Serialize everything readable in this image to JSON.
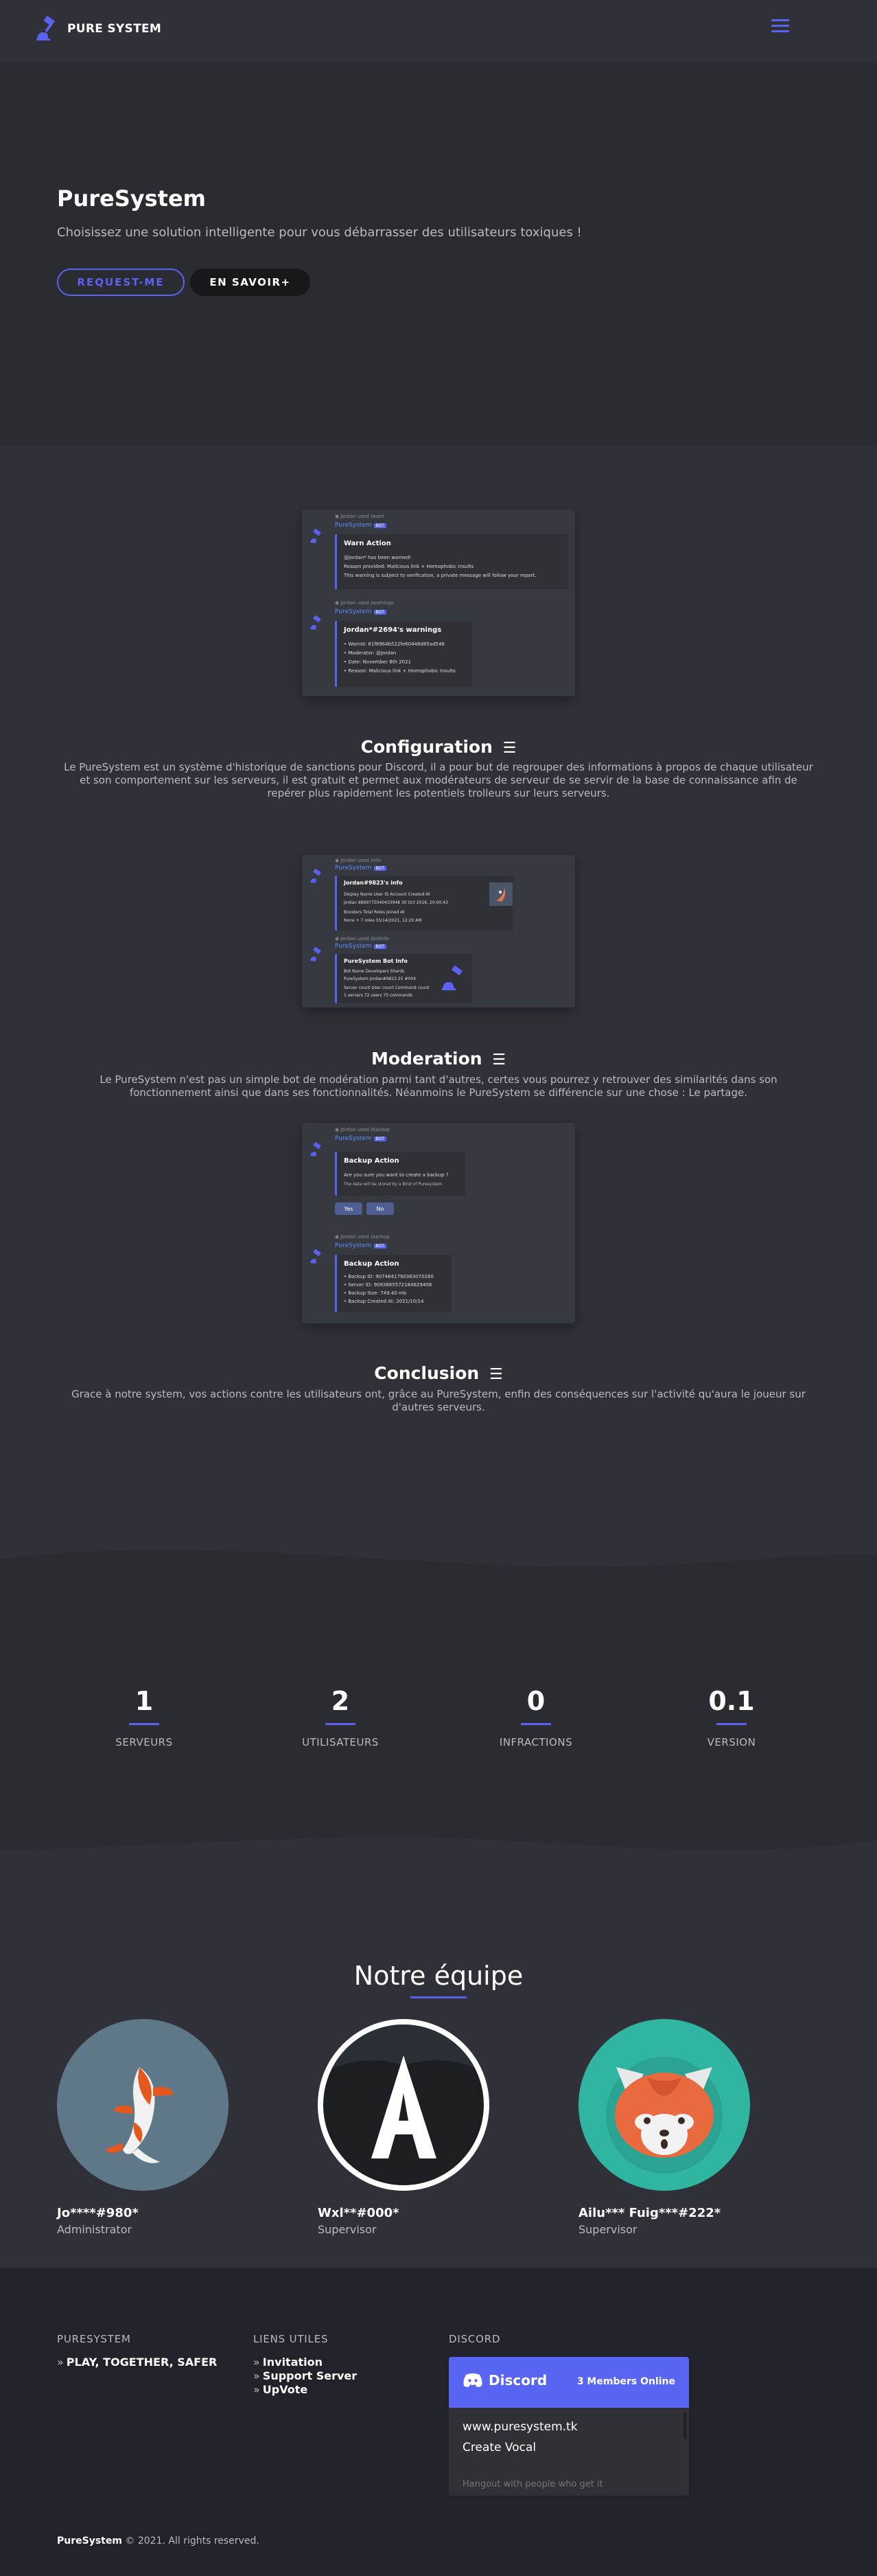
{
  "header": {
    "brand": "PURE SYSTEM"
  },
  "hero": {
    "title": "PureSystem",
    "subtitle": "Choisissez une solution intelligente pour vous débarrasser des utilisateurs toxiques !",
    "request_button": "REQUEST-ME",
    "savoir_button": "EN SAVOIR+"
  },
  "features": [
    {
      "title": "Configuration",
      "description": "Le PureSystem est un système d'historique de sanctions pour Discord, il a pour but de regrouper des informations à propos de chaque utilisateur et son comportement sur les serveurs, il est gratuit et permet aux modérateurs de serveur de se servir de la base de connaissance afin de repérer plus rapidement les potentiels trolleurs sur leurs serveurs."
    },
    {
      "title": "Moderation",
      "description": "Le PureSystem n'est pas un simple bot de modération parmi tant d'autres, certes vous pourrez y retrouver des similarités dans son fonctionnement ainsi que dans ses fonctionnalités. Néanmoins le PureSystem se différencie sur une chose : Le partage."
    },
    {
      "title": "Conclusion",
      "description": "Grace à notre system, vos actions contre les utilisateurs ont, grâce au PureSystem, enfin des conséquences sur l'activité qu'aura le joueur sur d'autres serveurs."
    }
  ],
  "screens": {
    "bot_name": "PureSystem",
    "bot_tag": "BOT",
    "warn": {
      "title": "Warn Action",
      "line1": "@Jordan* has been warned!",
      "line2": "Reason provided: Malicious link + Homophobic insults",
      "line3": "This warning is subject to verification, a private message will follow your report."
    },
    "warnings": {
      "title": "Jordan*#2694's warnings",
      "line1": "• WarnId: 61f8964b522fe60446d85ad546",
      "line2": "• Moderator: @Jordan",
      "line3": "• Date: November 8th 2021",
      "line4": "• Reason: Malicious link + Homophobic insults"
    },
    "info": {
      "title": "Jordan#9823's info",
      "line1": "Display Name   User ID   Account Created At",
      "line2": "Jordan   8899775040433948   30 Oct 2018, 20:00:43",
      "line3": "Boosters   Total Roles   Joined At",
      "line4": "None   + 7 roles   05/14/2021, 12:20 AM"
    },
    "botinfo": {
      "title": "PureSystem Bot Info",
      "line1": "Bot Name   Developers   Shards",
      "line2": "PureSystem   Jordan#9823   25 #004",
      "line3": "Server count   User count   Command count",
      "line4": "1 servers   72 users   75 commands"
    },
    "backup": {
      "title": "Backup Action",
      "line1": "Are you sure you want to create a backup ?",
      "line2": "The data will be stored by a Bind of Puresystem",
      "yes": "Yes",
      "no": "No"
    },
    "backup2": {
      "title": "Backup Action",
      "line1": "• Backup ID: 9074641790383070260",
      "line2": "• Server ID: 9093865572184629408",
      "line3": "• Backup Size: 749.40 mb",
      "line4": "• Backup Created At: 2021/10/14"
    }
  },
  "stats": [
    {
      "value": "1",
      "label": "SERVEURS"
    },
    {
      "value": "2",
      "label": "UTILISATEURS"
    },
    {
      "value": "0",
      "label": "INFRACTIONS"
    },
    {
      "value": "0.1",
      "label": "VERSION"
    }
  ],
  "team": {
    "title": "Notre équipe",
    "members": [
      {
        "name": "Jo****#980*",
        "role": "Administrator"
      },
      {
        "name": "Wxl**#000*",
        "role": "Supervisor"
      },
      {
        "name": "Ailu*** Fuig***#222*",
        "role": "Supervisor"
      }
    ]
  },
  "footer": {
    "col1_title": "PURESYSTEM",
    "col1_item": "PLAY, TOGETHER, SAFER",
    "col2_title": "LIENS UTILES",
    "links": [
      "Invitation",
      "Support Server",
      "UpVote"
    ],
    "col3_title": "DISCORD",
    "widget": {
      "brand": "Discord",
      "online": "3 Members Online",
      "link1": "www.puresystem.tk",
      "link2": "Create Vocal",
      "footer": "Hangout with people who get it"
    },
    "copyright_brand": "PureSystem",
    "copyright_text": " © 2021. All rights reserved."
  },
  "colors": {
    "accent": "#5b61f0",
    "page_bg": "#303138",
    "band_bg": "#2b2c32",
    "footer_bg": "#22232a",
    "discord_blurple": "#5865f2"
  }
}
